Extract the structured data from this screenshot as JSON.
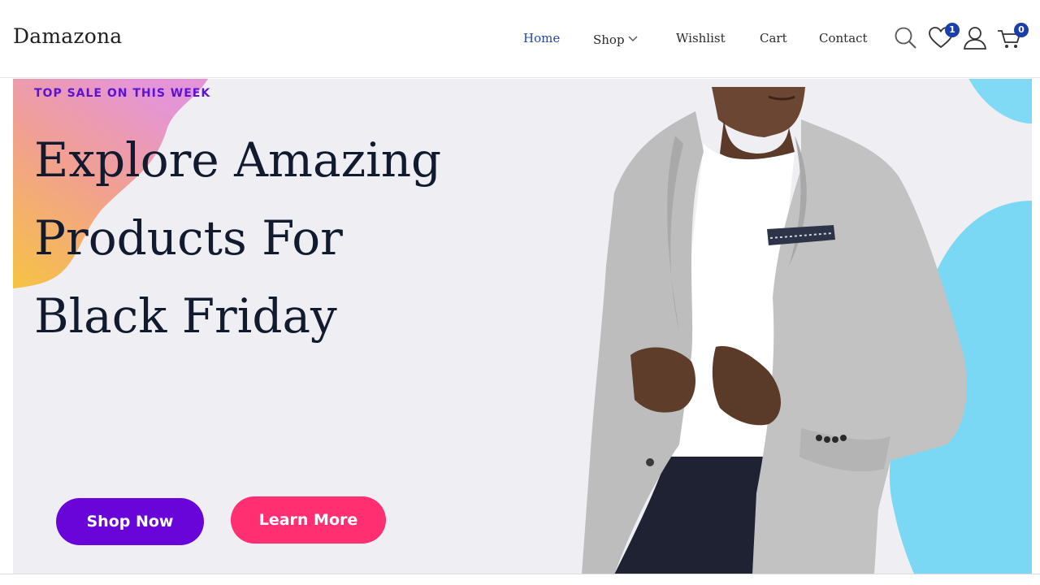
{
  "header": {
    "logo": "Damazona",
    "nav": [
      {
        "label": "Home",
        "active": true
      },
      {
        "label": "Shop",
        "has_dropdown": true
      },
      {
        "label": "Wishlist"
      },
      {
        "label": "Cart"
      },
      {
        "label": "Contact"
      }
    ],
    "icons": {
      "search": "search-icon",
      "wishlist": {
        "icon": "heart-icon",
        "count": "1"
      },
      "account": "user-icon",
      "cart": {
        "icon": "cart-icon",
        "count": "0"
      }
    },
    "accent_color": "#2348a9"
  },
  "hero": {
    "eyebrow": "TOP SALE ON THIS WEEK",
    "headline_lines": [
      "Explore Amazing",
      "Products For",
      "Black Friday"
    ],
    "buttons": {
      "shop_now": {
        "label": "Shop Now",
        "color": "#6a05da"
      },
      "learn_more": {
        "label": "Learn More",
        "color": "#ff2f72"
      }
    },
    "background_color": "#efeff3",
    "blob_colors": [
      "#f6c343",
      "#f2a08f",
      "#e595d6",
      "#7ad8f4"
    ]
  }
}
